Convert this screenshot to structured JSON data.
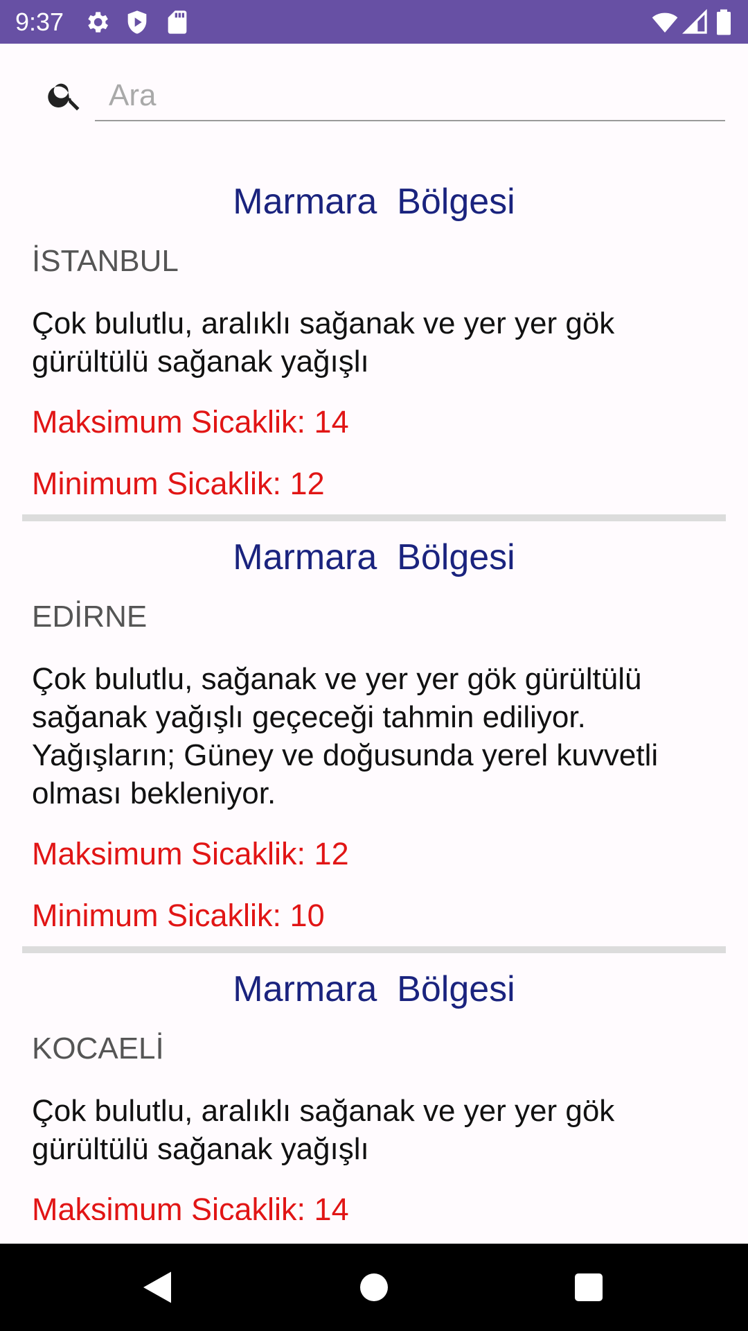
{
  "status_bar": {
    "time": "9:37",
    "icons": [
      "gear-icon",
      "shield-icon",
      "sd-card-icon",
      "wifi-icon",
      "signal-icon",
      "battery-icon"
    ]
  },
  "search": {
    "placeholder": "Ara",
    "value": ""
  },
  "items": [
    {
      "region": "Marmara  Bölgesi",
      "city": "İSTANBUL",
      "description": "Çok bulutlu, aralıklı sağanak ve yer yer gök gürültülü sağanak yağışlı",
      "max_temp": "Maksimum Sicaklik: 14",
      "min_temp": "Minimum Sicaklik: 12"
    },
    {
      "region": "Marmara  Bölgesi",
      "city": "EDİRNE",
      "description": "Çok bulutlu, sağanak ve yer yer gök gürültülü sağanak yağışlı geçeceği tahmin ediliyor. Yağışların; Güney ve doğusunda yerel kuvvetli olması bekleniyor.",
      "max_temp": "Maksimum Sicaklik: 12",
      "min_temp": "Minimum Sicaklik: 10"
    },
    {
      "region": "Marmara  Bölgesi",
      "city": "KOCAELİ",
      "description": "Çok bulutlu, aralıklı sağanak ve yer yer gök gürültülü sağanak yağışlı",
      "max_temp": "Maksimum Sicaklik: 14",
      "min_temp": ""
    }
  ],
  "nav_bar": {
    "icons": [
      "back-icon",
      "home-icon",
      "recents-icon"
    ]
  },
  "colors": {
    "status_bar": "#6750a4",
    "region_text": "#1a237e",
    "temperature_text": "#e11515",
    "divider": "#dcdcdc"
  }
}
